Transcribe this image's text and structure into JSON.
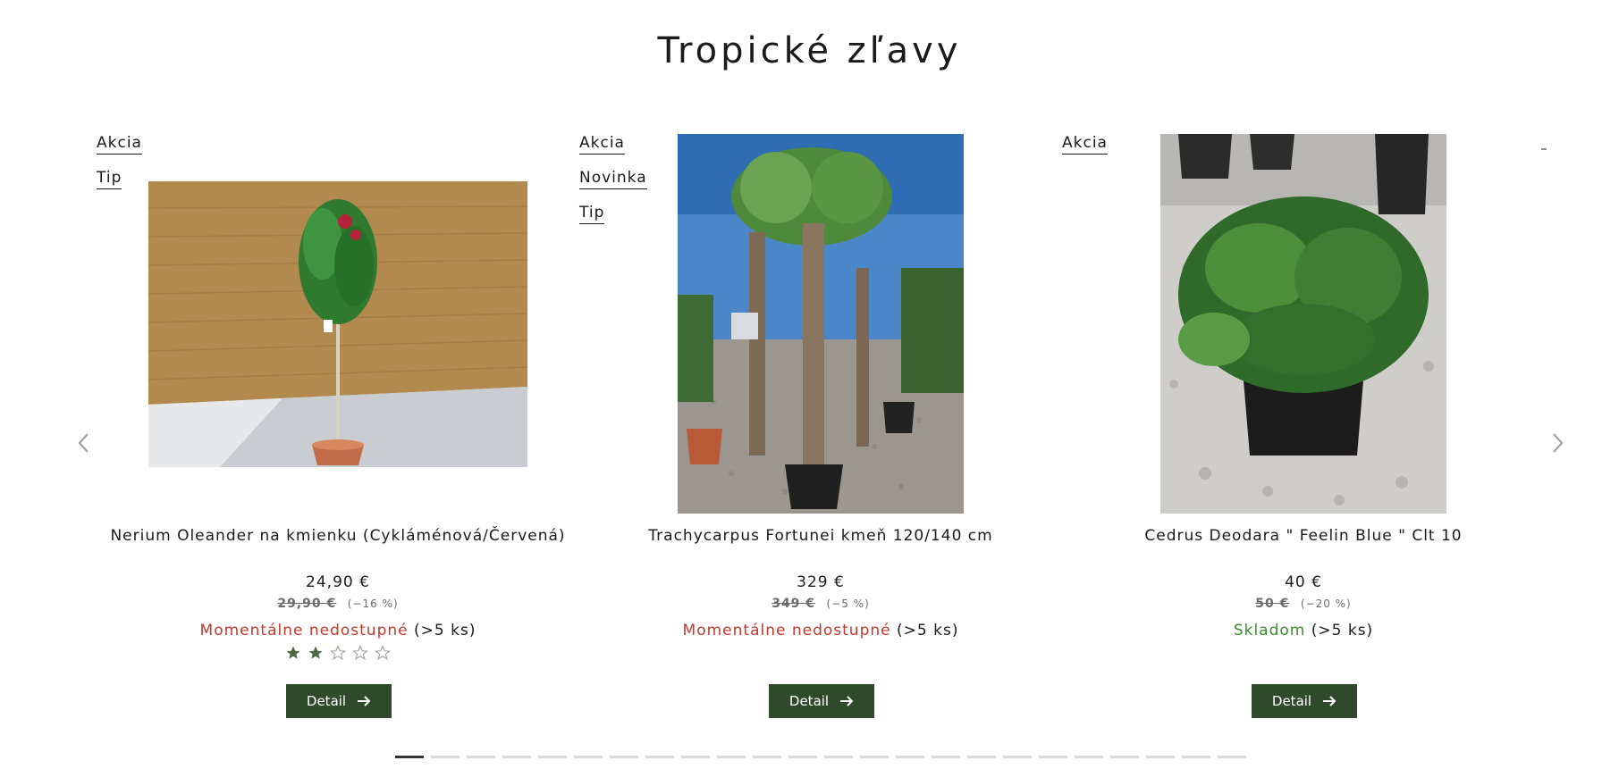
{
  "section": {
    "title": "Tropické zľavy"
  },
  "carousel": {
    "prev_icon": "chevron-left-icon",
    "next_icon": "chevron-right-icon",
    "dots_count": 24,
    "active_dot_index": 0,
    "products": [
      {
        "badges": [
          "Akcia",
          "Tip"
        ],
        "name": "Nerium Oleander na kmienku (Cykláménová/Červená)",
        "price": "24,90 €",
        "old_price": "29,90 €",
        "discount": "(−16 %)",
        "stock_status": "Momentálne nedostupné",
        "stock_qty": "(>5 ks)",
        "stock_color": "#c0392b",
        "rating": 2,
        "rating_max": 5,
        "detail_label": "Detail"
      },
      {
        "badges": [
          "Akcia",
          "Novinka",
          "Tip"
        ],
        "name": "Trachycarpus Fortunei kmeň 120/140 cm",
        "price": "329 €",
        "old_price": "349 €",
        "discount": "(−5 %)",
        "stock_status": "Momentálne nedostupné",
        "stock_qty": "(>5 ks)",
        "stock_color": "#c0392b",
        "detail_label": "Detail"
      },
      {
        "badges": [
          "Akcia"
        ],
        "name": "Cedrus Deodara \" Feelin Blue \" Clt 10",
        "price": "40 €",
        "old_price": "50 €",
        "discount": "(−20 %)",
        "stock_status": "Skladom",
        "stock_qty": "(>5 ks)",
        "stock_color": "#3d8a2e",
        "detail_label": "Detail"
      }
    ]
  },
  "colors": {
    "button_bg": "#2f4a2a",
    "star_filled": "#4f6b45",
    "star_empty": "#9aa598"
  }
}
